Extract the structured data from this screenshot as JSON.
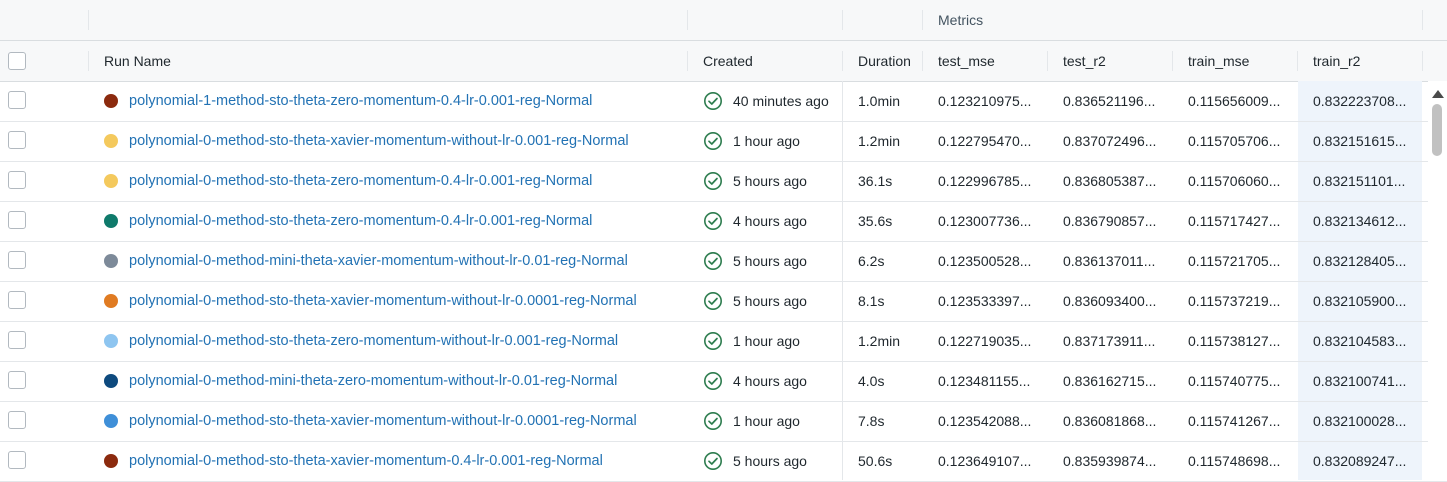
{
  "group_header": {
    "metrics_label": "Metrics"
  },
  "columns": {
    "run_name": "Run Name",
    "created": "Created",
    "duration": "Duration",
    "test_mse": "test_mse",
    "test_r2": "test_r2",
    "train_mse": "train_mse",
    "train_r2": "train_r2"
  },
  "icons": {
    "status": "check-circle-icon",
    "sort": "sort-descending-icon",
    "status_color": "#2e7d4f"
  },
  "rows": [
    {
      "color": "#8b2a0e",
      "run_name": "polynomial-1-method-sto-theta-zero-momentum-0.4-lr-0.001-reg-Normal",
      "created": "40 minutes ago",
      "duration": "1.0min",
      "test_mse": "0.123210975...",
      "test_r2": "0.836521196...",
      "train_mse": "0.115656009...",
      "train_r2": "0.832223708..."
    },
    {
      "color": "#f4c95d",
      "run_name": "polynomial-0-method-sto-theta-xavier-momentum-without-lr-0.001-reg-Normal",
      "created": "1 hour ago",
      "duration": "1.2min",
      "test_mse": "0.122795470...",
      "test_r2": "0.837072496...",
      "train_mse": "0.115705706...",
      "train_r2": "0.832151615..."
    },
    {
      "color": "#f4c95d",
      "run_name": "polynomial-0-method-sto-theta-zero-momentum-0.4-lr-0.001-reg-Normal",
      "created": "5 hours ago",
      "duration": "36.1s",
      "test_mse": "0.122996785...",
      "test_r2": "0.836805387...",
      "train_mse": "0.115706060...",
      "train_r2": "0.832151101..."
    },
    {
      "color": "#0f7a6b",
      "run_name": "polynomial-0-method-sto-theta-zero-momentum-0.4-lr-0.001-reg-Normal",
      "created": "4 hours ago",
      "duration": "35.6s",
      "test_mse": "0.123007736...",
      "test_r2": "0.836790857...",
      "train_mse": "0.115717427...",
      "train_r2": "0.832134612..."
    },
    {
      "color": "#7d8a99",
      "run_name": "polynomial-0-method-mini-theta-xavier-momentum-without-lr-0.01-reg-Normal",
      "created": "5 hours ago",
      "duration": "6.2s",
      "test_mse": "0.123500528...",
      "test_r2": "0.836137011...",
      "train_mse": "0.115721705...",
      "train_r2": "0.832128405..."
    },
    {
      "color": "#e07b22",
      "run_name": "polynomial-0-method-sto-theta-xavier-momentum-without-lr-0.0001-reg-Normal",
      "created": "5 hours ago",
      "duration": "8.1s",
      "test_mse": "0.123533397...",
      "test_r2": "0.836093400...",
      "train_mse": "0.115737219...",
      "train_r2": "0.832105900..."
    },
    {
      "color": "#8ec5f0",
      "run_name": "polynomial-0-method-sto-theta-zero-momentum-without-lr-0.001-reg-Normal",
      "created": "1 hour ago",
      "duration": "1.2min",
      "test_mse": "0.122719035...",
      "test_r2": "0.837173911...",
      "train_mse": "0.115738127...",
      "train_r2": "0.832104583..."
    },
    {
      "color": "#0e4a7e",
      "run_name": "polynomial-0-method-mini-theta-zero-momentum-without-lr-0.01-reg-Normal",
      "created": "4 hours ago",
      "duration": "4.0s",
      "test_mse": "0.123481155...",
      "test_r2": "0.836162715...",
      "train_mse": "0.115740775...",
      "train_r2": "0.832100741..."
    },
    {
      "color": "#3f8fd8",
      "run_name": "polynomial-0-method-sto-theta-xavier-momentum-without-lr-0.0001-reg-Normal",
      "created": "1 hour ago",
      "duration": "7.8s",
      "test_mse": "0.123542088...",
      "test_r2": "0.836081868...",
      "train_mse": "0.115741267...",
      "train_r2": "0.832100028..."
    },
    {
      "color": "#8b2a0e",
      "run_name": "polynomial-0-method-sto-theta-xavier-momentum-0.4-lr-0.001-reg-Normal",
      "created": "5 hours ago",
      "duration": "50.6s",
      "test_mse": "0.123649107...",
      "test_r2": "0.835939874...",
      "train_mse": "0.115748698...",
      "train_r2": "0.832089247..."
    }
  ]
}
